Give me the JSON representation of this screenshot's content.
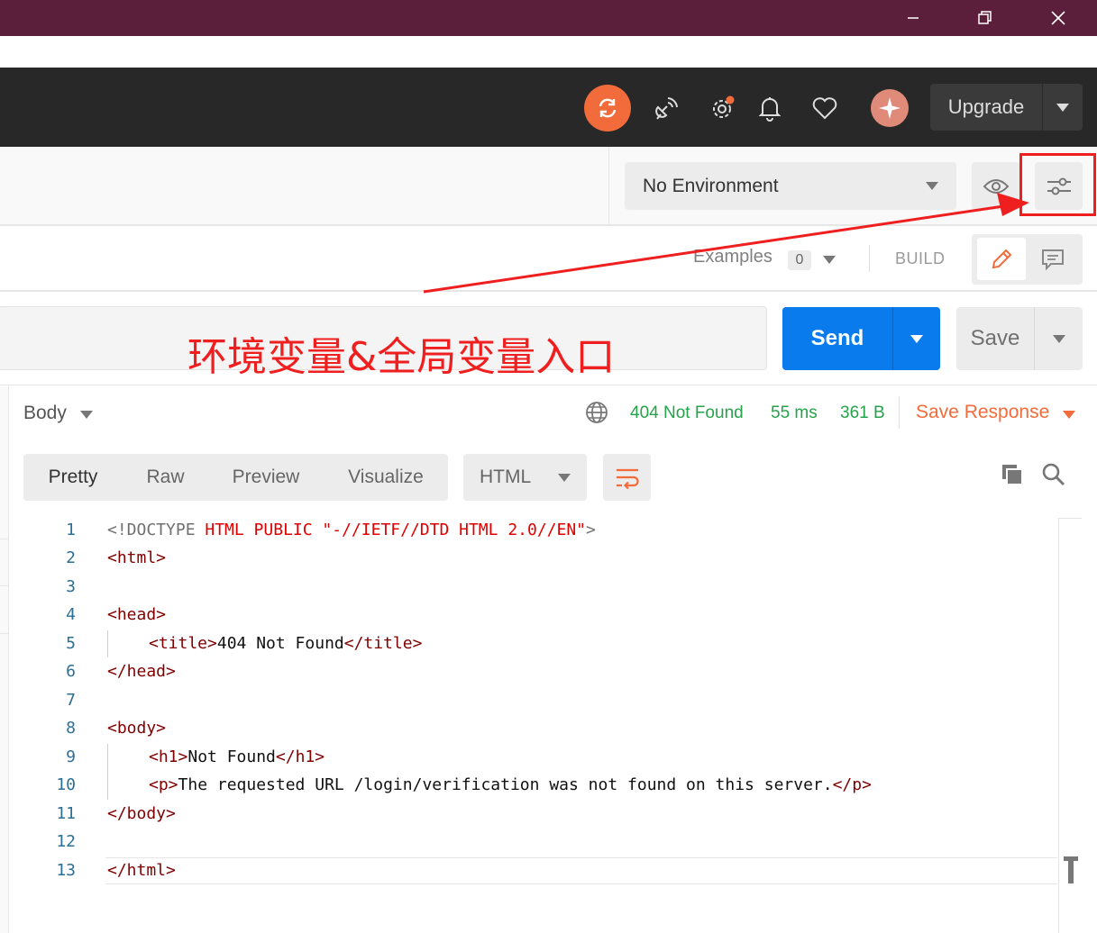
{
  "window": {
    "controls": [
      "minimize",
      "maximize",
      "close"
    ]
  },
  "header": {
    "icons": [
      "sync-icon",
      "satellite-icon",
      "settings-icon",
      "bell-icon",
      "heart-icon",
      "avatar-icon"
    ],
    "upgrade_label": "Upgrade",
    "accent": "#f26b3a"
  },
  "environment": {
    "selected": "No Environment"
  },
  "request_bar": {
    "examples_label": "Examples",
    "examples_count": "0",
    "build_label": "BUILD",
    "send_label": "Send",
    "save_label": "Save"
  },
  "annotation": {
    "text": "环境变量&全局变量入口",
    "color": "#f01f1f"
  },
  "response": {
    "body_label": "Body",
    "status": "404 Not Found",
    "time": "55 ms",
    "size": "361 B",
    "save_response_label": "Save Response",
    "status_color": "#26a34a"
  },
  "view_tabs": [
    "Pretty",
    "Raw",
    "Preview",
    "Visualize"
  ],
  "language": "HTML",
  "code": {
    "line_numbers": [
      "1",
      "2",
      "3",
      "4",
      "5",
      "6",
      "7",
      "8",
      "9",
      "10",
      "11",
      "12",
      "13"
    ],
    "l1_a": "<!DOCTYPE ",
    "l1_b": "HTML PUBLIC \"-//IETF//DTD HTML 2.0//EN\"",
    "l1_c": ">",
    "l2": "<html>",
    "l4": "<head>",
    "l5_open": "<title>",
    "l5_text": "404 Not Found",
    "l5_close": "</title>",
    "l6": "</head>",
    "l8": "<body>",
    "l9_open": "<h1>",
    "l9_text": "Not Found",
    "l9_close": "</h1>",
    "l10_open": "<p>",
    "l10_text": "The requested URL /login/verification was not found on this server.",
    "l10_close": "</p>",
    "l11": "</body>",
    "l13": "</html>"
  }
}
